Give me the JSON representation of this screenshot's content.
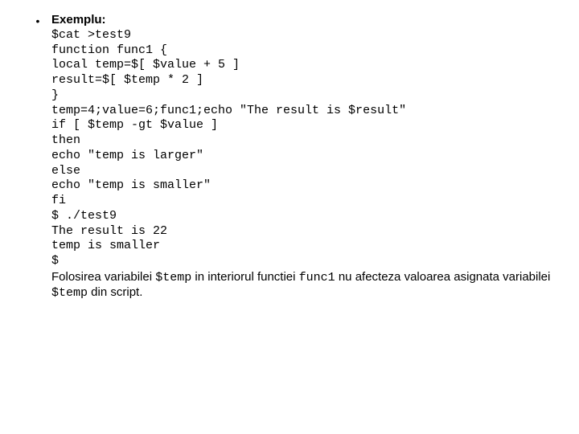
{
  "bullet": "•",
  "heading": "Exemplu:",
  "code_lines": [
    "$cat >test9",
    "function func1 {",
    "local temp=$[ $value + 5 ]",
    "result=$[ $temp * 2 ]",
    "}",
    "temp=4;value=6;func1;echo \"The result is $result\"",
    "if [ $temp -gt $value ]",
    "then",
    "echo \"temp is larger\"",
    "else",
    "echo \"temp is smaller\"",
    "fi",
    "$ ./test9",
    "The result is 22",
    "temp is smaller",
    "$"
  ],
  "explain": {
    "t1": "Folosirea variabilei ",
    "c1": "$temp",
    "t2": " in interiorul functiei ",
    "c2": "func1",
    "t3": " nu afecteza valoarea asignata variabilei ",
    "c3": "$temp",
    "t4": " din script."
  }
}
